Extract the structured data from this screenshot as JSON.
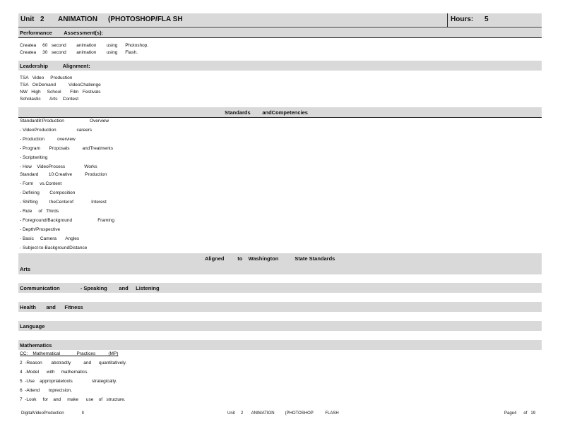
{
  "header": {
    "unit_label": "Unit",
    "unit_number": "2",
    "unit_title": "ANIMATION",
    "unit_subtitle": "(PHOTOSHOP/FLA SH",
    "hours_label": "Hours:",
    "hours_value": "5"
  },
  "performance": {
    "heading": "Performance        Assessment(s):",
    "items": [
      "Createa     60   second        animation        using      Photoshop.",
      "Createa     30   second        animation        using      Flash."
    ]
  },
  "leadership": {
    "heading": "Leadership          Alignment:",
    "items": [
      "TSA   Video     Production",
      "TSA   OnDemand          VideoChallenge",
      "NW   High     School       Film   Festivals",
      "Scholastic       Arts    Contest"
    ]
  },
  "standards": {
    "heading": "Standards        andCompetencies",
    "items": [
      "Standard8:Production                    Overview",
      "- VideoProduction                careers",
      "- Production          overview",
      "- Program       Proposals          andTreatments",
      "- Scriptwriting",
      "- How    VideoProcess               Works",
      "Standard        10:Creative          Production",
      "- Form     vs.Content",
      "- Defining        Composition",
      "- Shifting         theCenterof              Interest",
      "- Rule     of   Thirds",
      "- Foreground/Background                    Framing",
      "- Depth/Prospective",
      "- Basic     Camera       Angles",
      "- Subject-to-BackgroundDistance"
    ]
  },
  "washington": {
    "heading": "Aligned         to    Washington           State Standards",
    "arts": "Arts",
    "communication": "Communication              - Speaking        and     Listening",
    "health": "Health       and      Fitness",
    "language": "Language",
    "mathematics": "Mathematics"
  },
  "math": {
    "mp_heading": "CC:    Mathematical             Practices          (MP)",
    "items": [
      "2  -Reason       abstractly          and      quantitatively.",
      "4  -Model      with     mathematics.",
      "5  -Use    appropriatetools               strategically.",
      "6  -Attend       toprecision.",
      "7  -Look     for    and     make      use    of   structure."
    ]
  },
  "footer": {
    "left": "DigitalVideoProduction               II",
    "center": "Unit     2       ANIMATION         (PHOTOSHOP          FLASH",
    "right": "Page4      of   19"
  }
}
